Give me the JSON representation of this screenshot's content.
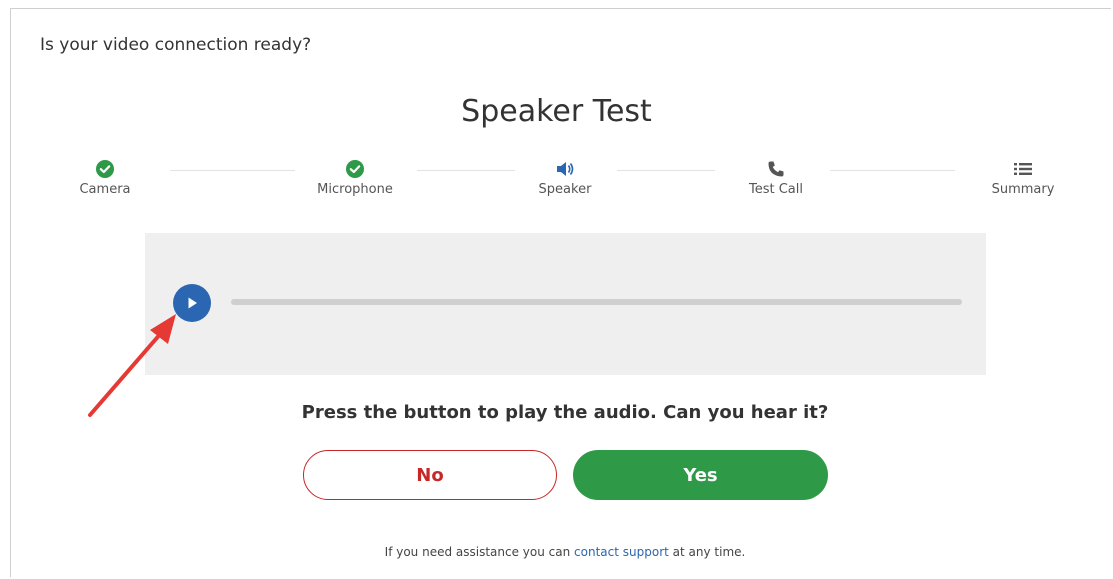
{
  "header": {
    "question": "Is your video connection ready?"
  },
  "page": {
    "title": "Speaker Test"
  },
  "steps": [
    {
      "label": "Camera",
      "icon": "check-circle-icon",
      "status": "done"
    },
    {
      "label": "Microphone",
      "icon": "check-circle-icon",
      "status": "done"
    },
    {
      "label": "Speaker",
      "icon": "speaker-icon",
      "status": "active"
    },
    {
      "label": "Test Call",
      "icon": "phone-icon",
      "status": "pending"
    },
    {
      "label": "Summary",
      "icon": "list-icon",
      "status": "pending"
    }
  ],
  "player": {
    "progress": 0
  },
  "prompt": {
    "question": "Press the button to play the audio. Can you hear it?"
  },
  "buttons": {
    "no": "No",
    "yes": "Yes"
  },
  "assistance": {
    "before": "If you need assistance you can ",
    "link": "contact support",
    "after": " at any time."
  },
  "colors": {
    "accent": "#2a66b1",
    "success": "#2e9a47",
    "danger": "#c62828",
    "annotation": "#e53935"
  }
}
